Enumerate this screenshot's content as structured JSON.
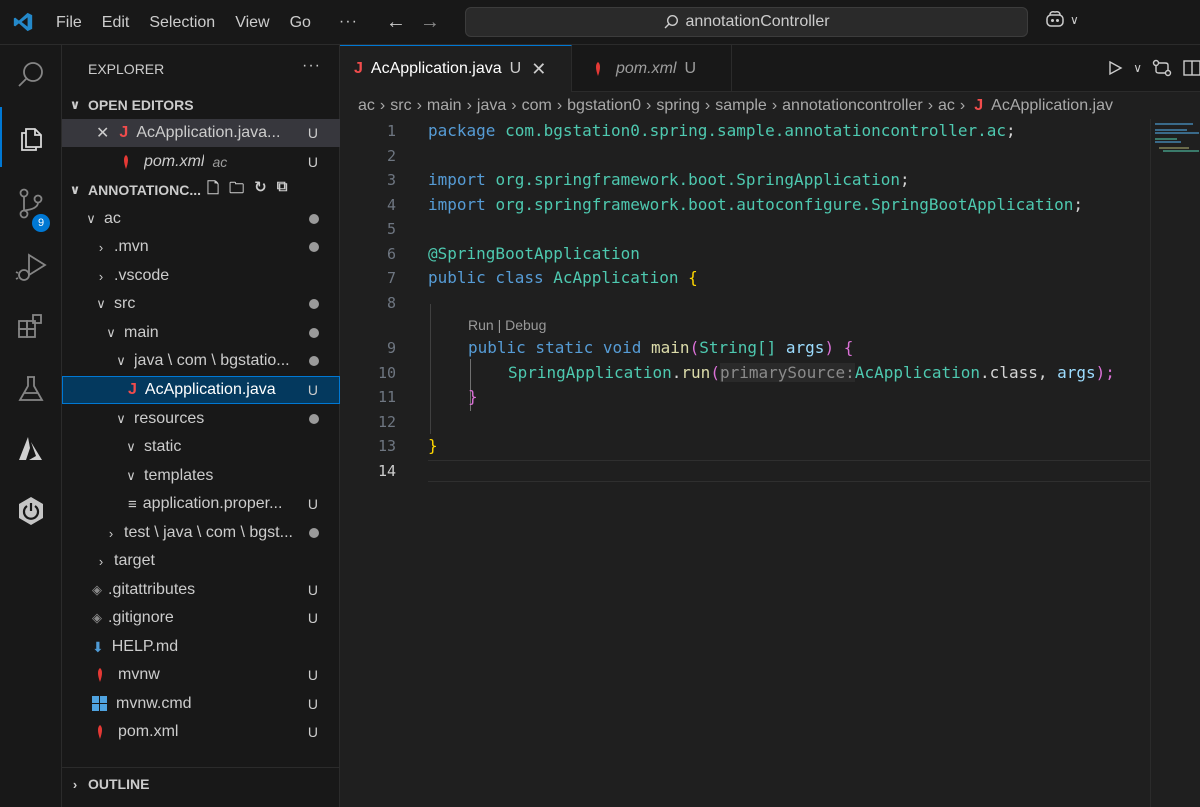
{
  "menubar": [
    "File",
    "Edit",
    "Selection",
    "View",
    "Go"
  ],
  "menu_more": "···",
  "command_center": {
    "text": "annotationController"
  },
  "activity_bar": {
    "items": [
      {
        "name": "search-icon"
      },
      {
        "name": "explorer-icon"
      },
      {
        "name": "source-control-icon",
        "badge": "9"
      },
      {
        "name": "run-debug-icon"
      },
      {
        "name": "extensions-icon"
      },
      {
        "name": "testing-icon"
      },
      {
        "name": "azure-icon"
      },
      {
        "name": "spring-boot-icon"
      }
    ]
  },
  "sidebar": {
    "title": "EXPLORER",
    "more": "···",
    "open_editors": {
      "label": "OPEN EDITORS",
      "items": [
        {
          "label": "AcApplication.java...",
          "status": "U"
        },
        {
          "label": "pom.xml",
          "suffix": "ac",
          "status": "U"
        }
      ]
    },
    "project": {
      "label": "ANNOTATIONC...",
      "tree": [
        {
          "label": "ac"
        },
        {
          "label": ".mvn"
        },
        {
          "label": ".vscode"
        },
        {
          "label": "src"
        },
        {
          "label": "main"
        },
        {
          "label": "java \\ com \\ bgstatio..."
        },
        {
          "label": "AcApplication.java",
          "status": "U"
        },
        {
          "label": "resources"
        },
        {
          "label": "static"
        },
        {
          "label": "templates"
        },
        {
          "label": "application.proper...",
          "status": "U"
        },
        {
          "label": "test \\ java \\ com \\ bgst..."
        },
        {
          "label": "target"
        },
        {
          "label": ".gitattributes",
          "status": "U"
        },
        {
          "label": ".gitignore",
          "status": "U"
        },
        {
          "label": "HELP.md"
        },
        {
          "label": "mvnw",
          "status": "U"
        },
        {
          "label": "mvnw.cmd",
          "status": "U"
        },
        {
          "label": "pom.xml",
          "status": "U"
        }
      ]
    },
    "outline": "OUTLINE"
  },
  "tabs": [
    {
      "label": "AcApplication.java",
      "status": "U"
    },
    {
      "label": "pom.xml",
      "status": "U"
    }
  ],
  "breadcrumb": [
    "ac",
    "src",
    "main",
    "java",
    "com",
    "bgstation0",
    "spring",
    "sample",
    "annotationcontroller",
    "ac",
    "AcApplication.jav"
  ],
  "editor": {
    "line_numbers": [
      "1",
      "2",
      "3",
      "4",
      "5",
      "6",
      "7",
      "8",
      "9",
      "10",
      "11",
      "12",
      "13",
      "14"
    ],
    "codelens": "Run | Debug",
    "code": {
      "l1_kw": "package",
      "l1_pkg": "com.bgstation0.spring.sample.annotationcontroller.ac",
      "l1_end": ";",
      "l3_kw": "import",
      "l3_pkg": "org.springframework.boot.SpringApplication",
      "l3_end": ";",
      "l4_kw": "import",
      "l4_pkg": "org.springframework.boot.autoconfigure.SpringBootApplication",
      "l4_end": ";",
      "l6_ann": "@SpringBootApplication",
      "l7_kw": "public class",
      "l7_cls": "AcApplication",
      "l7_brace": "{",
      "l9_kw": "public static void",
      "l9_method": "main",
      "l9_paren_open": "(",
      "l9_type": "String[]",
      "l9_param": "args",
      "l9_paren_close": ")",
      "l9_brace": "{",
      "l10_cls": "SpringApplication",
      "l10_dot": ".",
      "l10_method": "run",
      "l10_paren_open": "(",
      "l10_hint": "primarySource:",
      "l10_cls2": "AcApplication",
      "l10_dotclass": ".class,",
      "l10_args": "args",
      "l10_end": ");",
      "l11_brace": "}",
      "l13_brace": "}"
    }
  },
  "colors": {
    "accent": "#0078d4",
    "java_icon": "#f14c4c",
    "keyword": "#569cd6",
    "type": "#4ec9b0"
  }
}
